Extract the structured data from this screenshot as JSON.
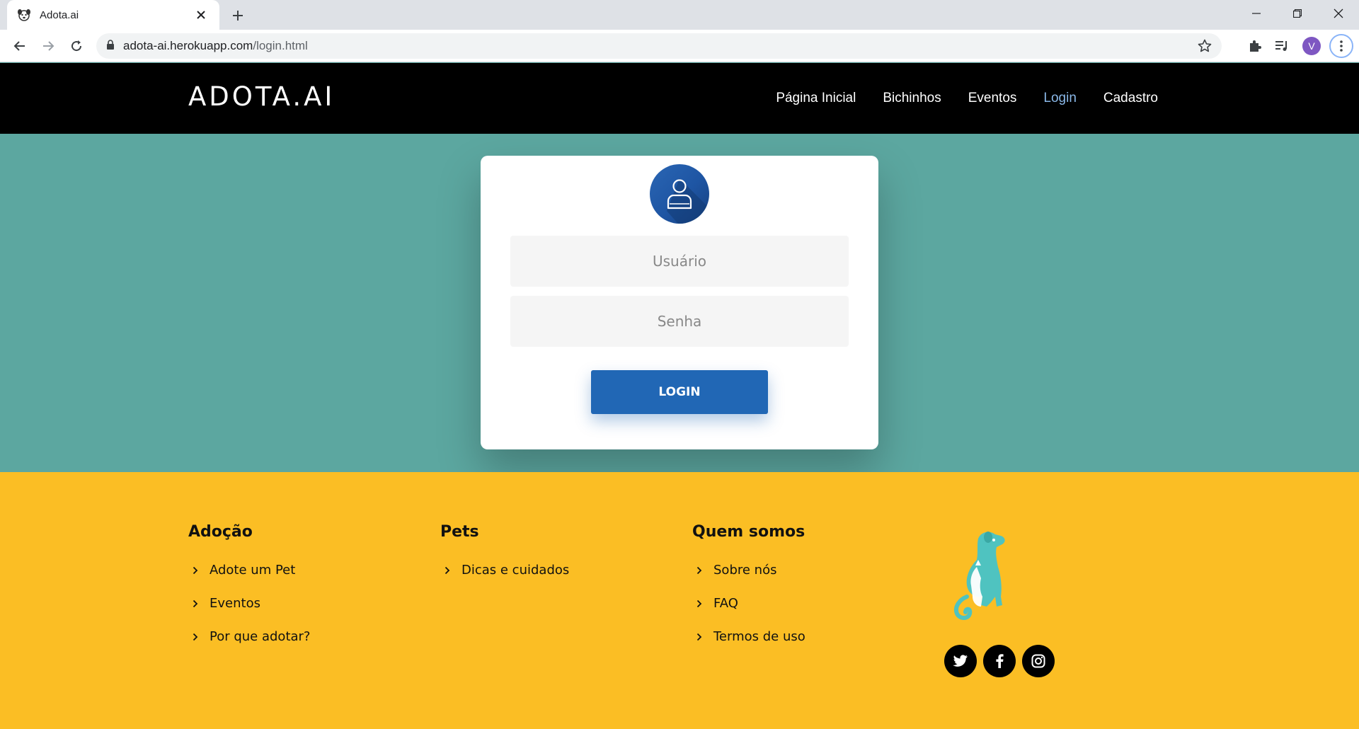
{
  "browser": {
    "tab_title": "Adota.ai",
    "url_host": "adota-ai.herokuapp.com",
    "url_path": "/login.html",
    "profile_initial": "V"
  },
  "site": {
    "brand": "ADOTA.AI",
    "nav": [
      "Página Inicial",
      "Bichinhos",
      "Eventos",
      "Login",
      "Cadastro"
    ],
    "active_nav": "Login"
  },
  "login": {
    "username_placeholder": "Usuário",
    "password_placeholder": "Senha",
    "button_label": "LOGIN"
  },
  "footer": {
    "columns": [
      {
        "title": "Adoção",
        "items": [
          "Adote um Pet",
          "Eventos",
          "Por que adotar?"
        ]
      },
      {
        "title": "Pets",
        "items": [
          "Dicas e cuidados"
        ]
      },
      {
        "title": "Quem somos",
        "items": [
          "Sobre nós",
          "FAQ",
          "Termos de uso"
        ]
      }
    ],
    "socials": [
      "twitter-icon",
      "facebook-icon",
      "instagram-icon"
    ]
  },
  "colors": {
    "nav_bg": "#000000",
    "main_bg": "#5ca7a0",
    "footer_bg": "#fbbe24",
    "accent_blue": "#2167b5",
    "active_link": "#8ab8e8",
    "logo_teal": "#4fc3c0"
  }
}
